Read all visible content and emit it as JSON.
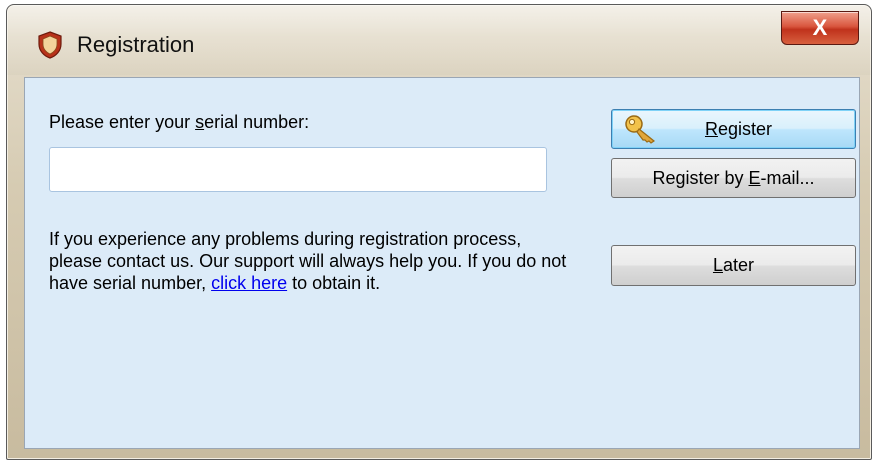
{
  "window": {
    "title": "Registration",
    "close_label": "X"
  },
  "form": {
    "prompt_pre": "Please enter your ",
    "prompt_u": "s",
    "prompt_post": "erial number:",
    "serial_value": "",
    "info_text": "If you experience any problems during registration process, please contact us. Our support will always help you. If you do not have serial number, ",
    "link_text": "click here",
    "info_tail": " to obtain it."
  },
  "buttons": {
    "register": {
      "u": "R",
      "rest": "egister"
    },
    "email": {
      "pre": "Register by ",
      "u": "E",
      "rest": "-mail..."
    },
    "later": {
      "u": "L",
      "rest": "ater"
    }
  },
  "icons": {
    "app": "shield-icon",
    "register": "key-icon"
  },
  "colors": {
    "client_bg": "#dcebf8",
    "link": "#0000ee",
    "close_red": "#c0321c"
  }
}
